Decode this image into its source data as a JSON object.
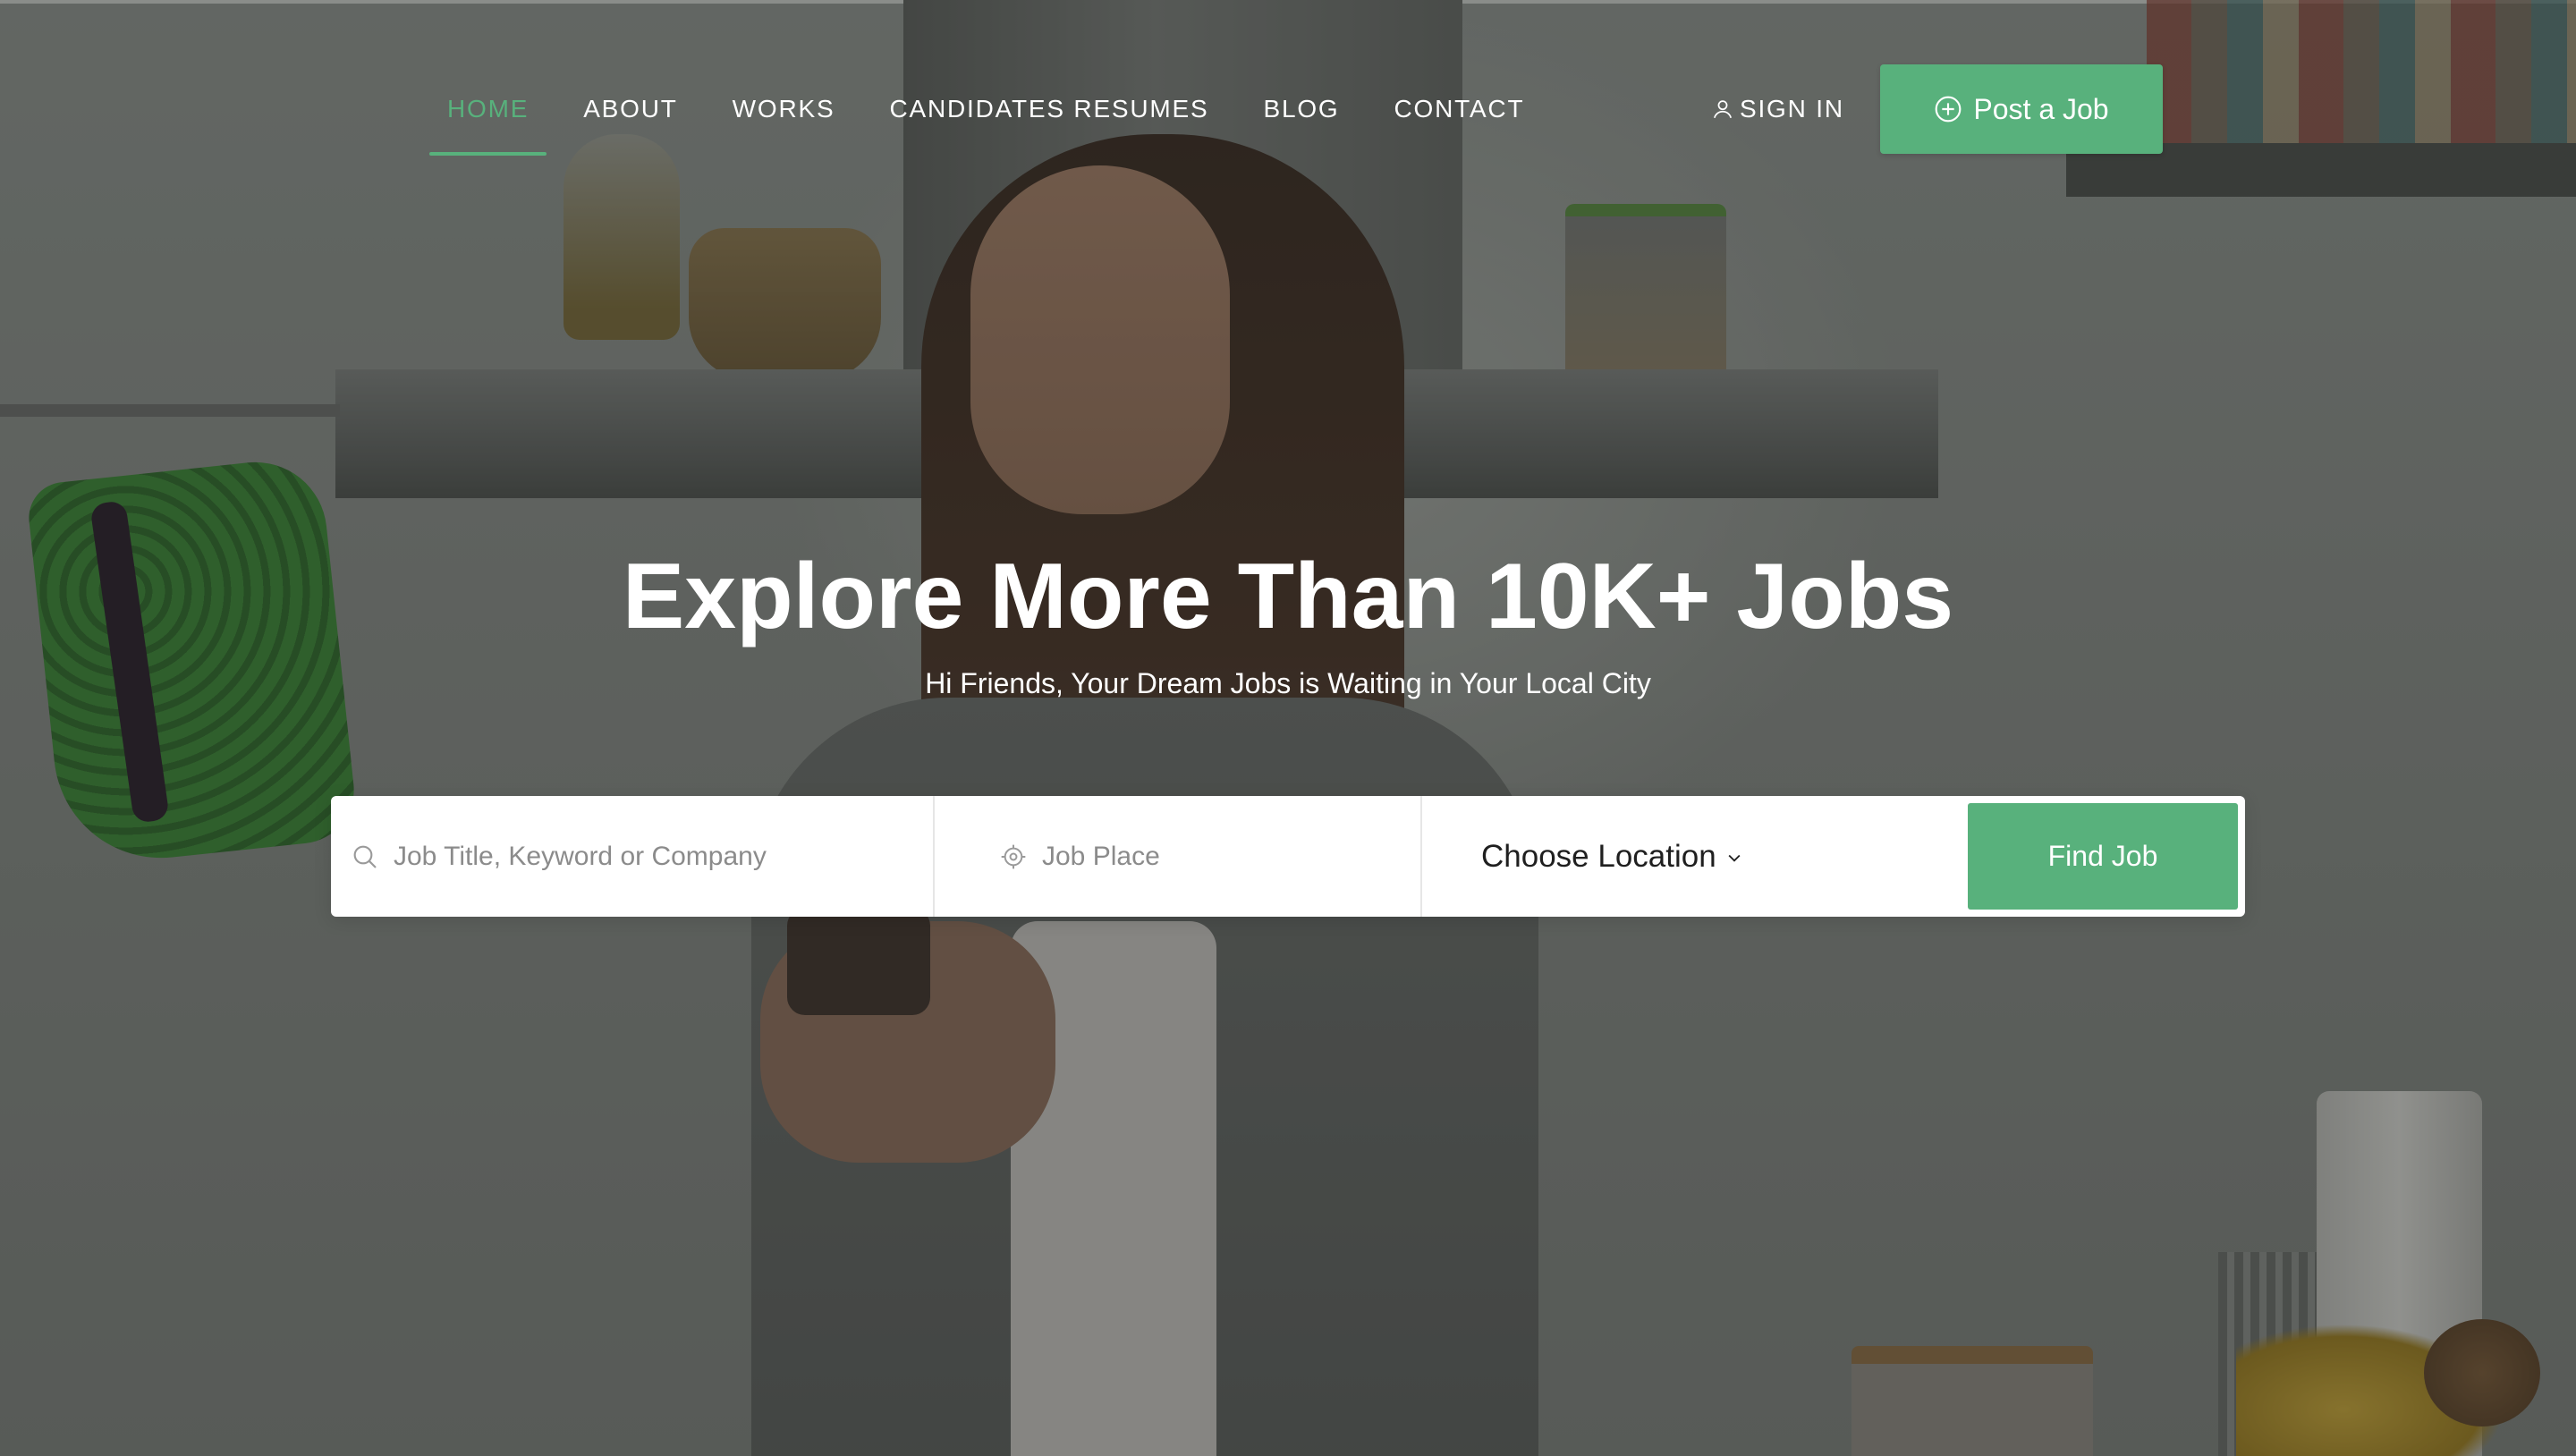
{
  "colors": {
    "accent": "#58b17c",
    "text_on_dark": "#ffffff",
    "overlay": "#191c1a"
  },
  "nav": {
    "items": [
      {
        "label": "HOME",
        "active": true
      },
      {
        "label": "ABOUT",
        "active": false
      },
      {
        "label": "WORKS",
        "active": false
      },
      {
        "label": "CANDIDATES RESUMES",
        "active": false
      },
      {
        "label": "BLOG",
        "active": false
      },
      {
        "label": "CONTACT",
        "active": false
      }
    ],
    "signin_label": "SIGN IN",
    "signin_icon": "user-icon",
    "post_job_label": "Post a Job",
    "post_job_icon": "plus-circle-icon"
  },
  "hero": {
    "title": "Explore More Than 10K+ Jobs",
    "subtitle": "Hi Friends, Your Dream Jobs is Waiting in Your Local City"
  },
  "search": {
    "keyword_placeholder": "Job Title, Keyword or Company",
    "keyword_icon": "search-icon",
    "place_placeholder": "Job Place",
    "place_icon": "location-target-icon",
    "location_label": "Choose Location",
    "location_icon": "chevron-down-icon",
    "submit_label": "Find Job"
  }
}
